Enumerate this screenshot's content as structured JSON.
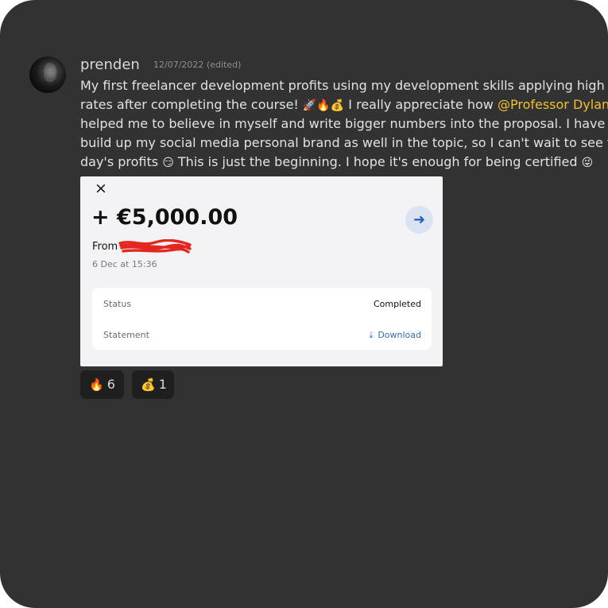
{
  "post": {
    "username": "prenden",
    "date": "12/07/2022",
    "edited": "(edited)",
    "lines": [
      "My first freelancer development profits using my development skills applying high e",
      "rates after completing the course! ",
      " I really appreciate how ",
      "helped me to believe in myself and write bigger numbers into the proposal. I have s",
      "build up my social media personal brand as well in the topic, so I can't wait to see t",
      "day's profits ",
      " This is just the beginning. I hope it's enough for being certified "
    ],
    "mention": "@Professor Dylan",
    "emoji": {
      "rocket": "🚀",
      "fire": "🔥",
      "money_bag": "💰",
      "smirk": "😏",
      "wink_tongue": "😜"
    }
  },
  "card": {
    "close_icon": "×",
    "amount": "+ €5,000.00",
    "from_label": "From",
    "date": "6 Dec at 15:36",
    "status_label": "Status",
    "status_value": "Completed",
    "statement_label": "Statement",
    "download_label": "Download",
    "download_icon": "⤓",
    "arrow_icon": "➜",
    "accent": "#1f5fb8",
    "redaction_color": "#e3261e"
  },
  "reactions": [
    {
      "emoji": "🔥",
      "count": "6"
    },
    {
      "emoji": "💰",
      "count": "1"
    }
  ],
  "colors": {
    "background": "#323232",
    "mention": "#f2c230",
    "text": "#e2e2e2"
  }
}
